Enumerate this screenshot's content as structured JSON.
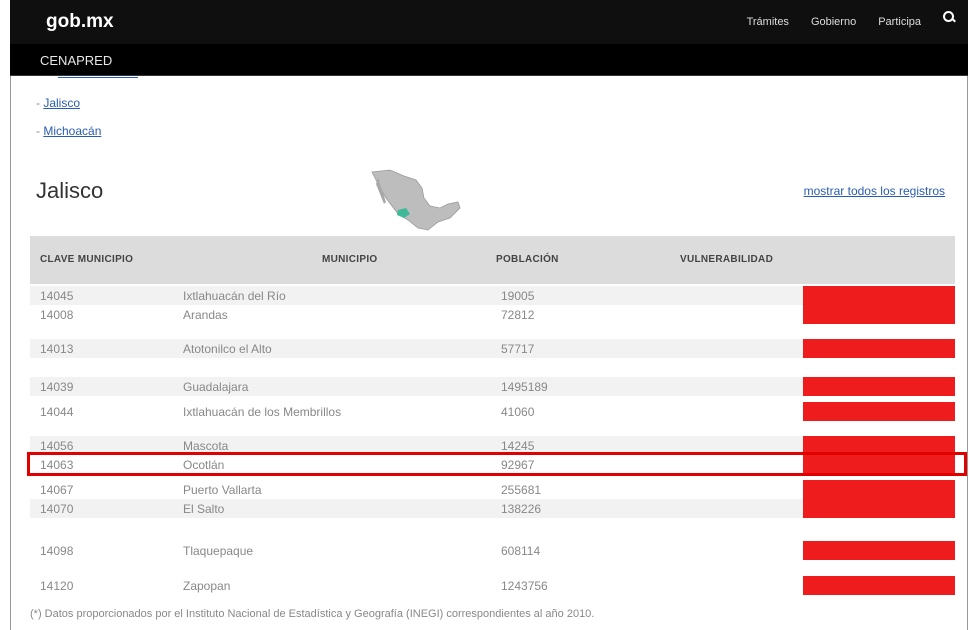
{
  "header": {
    "logo": "gob.mx",
    "nav": [
      "Trámites",
      "Gobierno",
      "Participa"
    ],
    "section": "CENAPRED"
  },
  "states_list": [
    {
      "prefix": "- ",
      "label": "Jalisco"
    },
    {
      "prefix": "- ",
      "label": "Michoacán"
    }
  ],
  "page": {
    "title": "Jalisco",
    "show_all_link": "mostrar todos los registros"
  },
  "table": {
    "headers": [
      "CLAVE MUNICIPIO",
      "MUNICIPIO",
      "POBLACIÓN",
      "VULNERABILIDAD"
    ],
    "rows": [
      {
        "clave": "14045",
        "municipio": "Ixtlahuacán del Río",
        "poblacion": "19005"
      },
      {
        "clave": "14008",
        "municipio": "Arandas",
        "poblacion": "72812"
      },
      {
        "clave": "14013",
        "municipio": "Atotonilco el Alto",
        "poblacion": "57717"
      },
      {
        "clave": "14039",
        "municipio": "Guadalajara",
        "poblacion": "1495189"
      },
      {
        "clave": "14044",
        "municipio": "Ixtlahuacán de los Membrillos",
        "poblacion": "41060"
      },
      {
        "clave": "14056",
        "municipio": "Mascota",
        "poblacion": "14245"
      },
      {
        "clave": "14063",
        "municipio": "Ocotlán",
        "poblacion": "92967"
      },
      {
        "clave": "14067",
        "municipio": "Puerto Vallarta",
        "poblacion": "255681"
      },
      {
        "clave": "14070",
        "municipio": "El Salto",
        "poblacion": "138226"
      },
      {
        "clave": "14098",
        "municipio": "Tlaquepaque",
        "poblacion": "608114"
      },
      {
        "clave": "14120",
        "municipio": "Zapopan",
        "poblacion": "1243756"
      }
    ]
  },
  "footnote": "(*) Datos proporcionados por el Instituto Nacional de Estadística y Geografía (INEGI) correspondientes al año 2010.",
  "colors": {
    "vulnerability": "#ee1c1c",
    "highlight": "#e10000",
    "topbar": "#0f0f0f"
  }
}
